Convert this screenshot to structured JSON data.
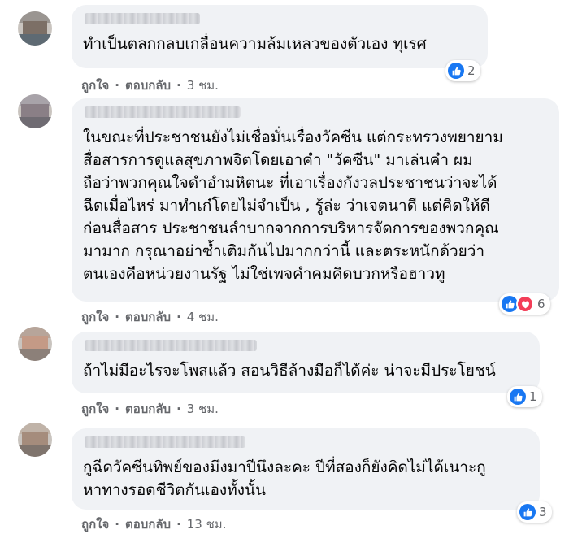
{
  "colors": {
    "like": "#1877f2",
    "love": "#f33e58",
    "bubble": "#f0f2f5",
    "meta": "#65676b"
  },
  "comments": [
    {
      "text": "ทำเป็นตลกกลบเกลื่อนความล้มเหลวของตัวเอง ทุเรศ",
      "like_label": "ถูกใจ",
      "reply_label": "ตอบกลับ",
      "time": "3 ชม.",
      "reactions": [
        "like-icon"
      ],
      "reaction_count": "2"
    },
    {
      "text": "ในขณะที่ประชาชนยังไม่เชื่อมั่นเรื่องวัคซีน แต่กระทรวงพยายาม\nสื่อสารการดูแลสุขภาพจิตโดยเอาคำ \"วัคซีน\" มาเล่นคำ ผม\nถือว่าพวกคุณใจดำอำมหิตนะ ที่เอาเรื่องกังวลประชาชนว่าจะได้\nฉีดเมื่อไหร่ มาทำเก๋โดยไม่จำเป็น , รู้ล่ะ ว่าเจตนาดี แต่คิดให้ดี\nก่อนสื่อสาร ประชาชนลำบากจากการบริหารจัดการของพวกคุณ\nมามาก กรุณาอย่าซ้ำเติมกันไปมากกว่านี้ และตระหนักด้วยว่า\nตนเองคือหน่วยงานรัฐ ไม่ใช่เพจคำคมคิดบวกหรือฮาวทู",
      "like_label": "ถูกใจ",
      "reply_label": "ตอบกลับ",
      "time": "4 ชม.",
      "reactions": [
        "like-icon",
        "love-icon"
      ],
      "reaction_count": "6"
    },
    {
      "text": "ถ้าไม่มีอะไรจะโพสแล้ว สอนวิธีล้างมือก็ได้ค่ะ น่าจะมีประโยชน์",
      "like_label": "ถูกใจ",
      "reply_label": "ตอบกลับ",
      "time": "3 ชม.",
      "reactions": [
        "like-icon"
      ],
      "reaction_count": "1"
    },
    {
      "text": "กูฉีดวัคซีนทิพย์ของมึงมาปีนึงละคะ ปีที่สองก็ยังคิดไม่ได้เนาะกู\nหาทางรอดชีวิตกันเองทั้งนั้น",
      "like_label": "ถูกใจ",
      "reply_label": "ตอบกลับ",
      "time": "13 ชม.",
      "reactions": [
        "like-icon"
      ],
      "reaction_count": "3"
    }
  ]
}
